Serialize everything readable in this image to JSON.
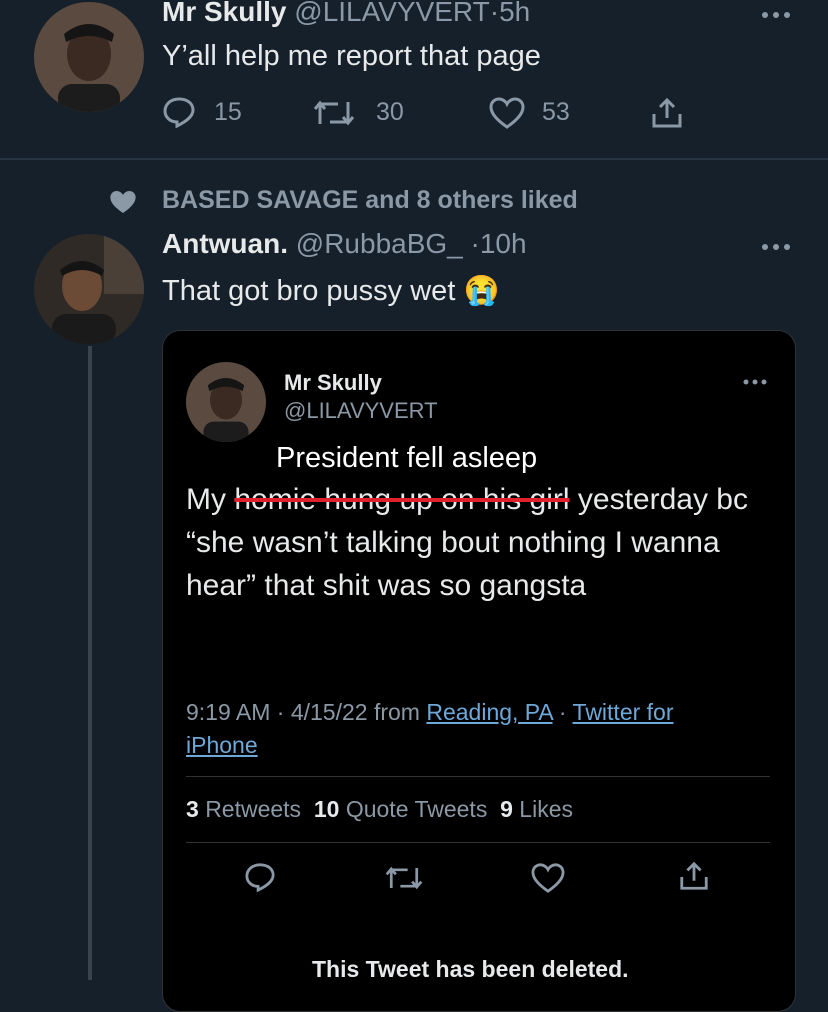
{
  "colors": {
    "background": "#15202b",
    "card": "#000000",
    "text": "#e7e9ea",
    "muted": "#8b98a5",
    "strike": "#e0202a",
    "link": "#6ea8d8"
  },
  "tweet1": {
    "name": "Mr Skully",
    "handle": "@LILAVYVERT",
    "sep": "·",
    "time": "5h",
    "text": "Y’all help me report that page",
    "reply_count": "15",
    "retweet_count": "30",
    "like_count": "53"
  },
  "social_context": {
    "text": "BASED SAVAGE and 8 others liked"
  },
  "tweet2": {
    "name": "Antwuan.",
    "handle": "@RubbaBG_",
    "sep": "·",
    "time": "10h",
    "text": "That got bro pussy wet",
    "emoji": "😭"
  },
  "quoted": {
    "name": "Mr Skully",
    "handle": "@LILAVYVERT",
    "overlay_text": "President fell asleep",
    "line1_prefix": "My ",
    "line1_struck": "homie hung up on his girl",
    "body_rest": "yesterday bc “she wasn’t talking bout nothing I wanna hear” that shit was so gangsta",
    "meta_time": "9:19 AM · 4/15/22 from ",
    "meta_location": "Reading, PA",
    "meta_sep": " · ",
    "meta_source": "Twitter for iPhone",
    "retweets_num": "3",
    "retweets_label": "Retweets",
    "quotes_num": "10",
    "quotes_label": "Quote Tweets",
    "likes_num": "9",
    "likes_label": "Likes",
    "deleted_notice": "This Tweet has been deleted."
  }
}
